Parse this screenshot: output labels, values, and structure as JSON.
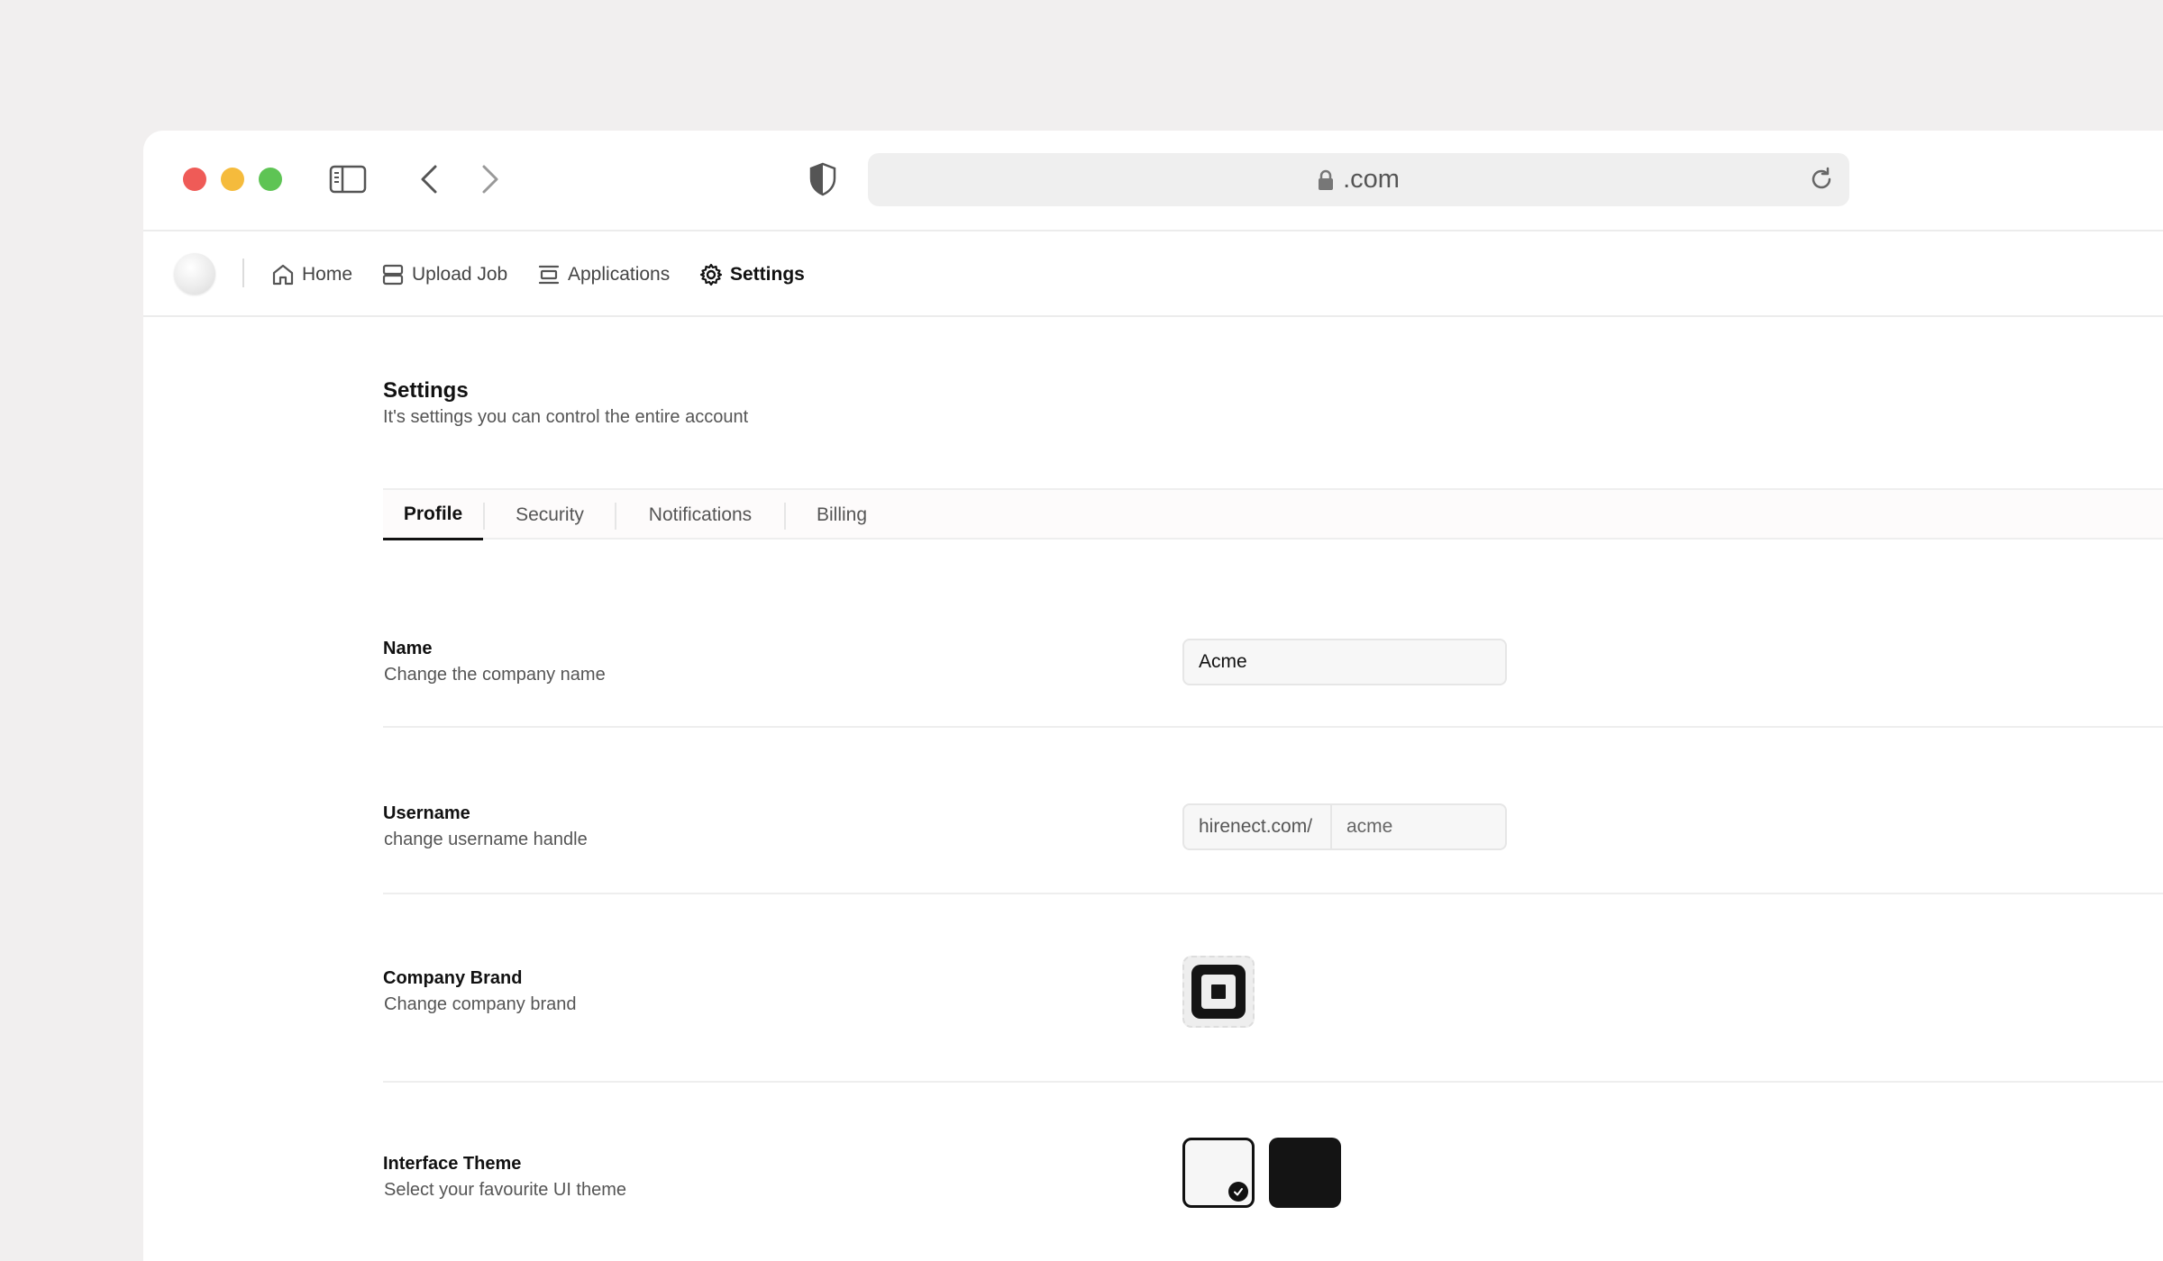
{
  "browser": {
    "url": ".com",
    "icons": {
      "sidebar_toggle": "sidebar-toggle-icon",
      "back": "chevron-left-icon",
      "forward": "chevron-right-icon",
      "privacy": "shield-icon",
      "lock": "lock-icon",
      "reload": "reload-icon"
    }
  },
  "nav": {
    "items": [
      {
        "label": "Home",
        "icon": "home-icon"
      },
      {
        "label": "Upload Job",
        "icon": "server-icon"
      },
      {
        "label": "Applications",
        "icon": "list-icon"
      },
      {
        "label": "Settings",
        "icon": "gear-icon",
        "active": true
      }
    ]
  },
  "page": {
    "title": "Settings",
    "subtitle": "It's settings you can control the entire account"
  },
  "tabs": [
    {
      "label": "Profile",
      "active": true
    },
    {
      "label": "Security"
    },
    {
      "label": "Notifications"
    },
    {
      "label": "Billing"
    }
  ],
  "rows": {
    "name": {
      "label": "Name",
      "desc": "Change the company name",
      "value": "Acme"
    },
    "username": {
      "label": "Username",
      "desc": "change username handle",
      "prefix": "hirenect.com/",
      "value": "acme"
    },
    "brand": {
      "label": "Company Brand",
      "desc": "Change company brand",
      "icon": "square-logo-icon"
    },
    "theme": {
      "label": "Interface Theme",
      "desc": "Select your favourite UI theme",
      "options": [
        "light",
        "dark"
      ],
      "selected": "light"
    }
  },
  "colors": {
    "traffic_red": "#ef5b57",
    "traffic_yellow": "#f5bb3c",
    "traffic_green": "#5ec454",
    "accent": "#111111"
  }
}
